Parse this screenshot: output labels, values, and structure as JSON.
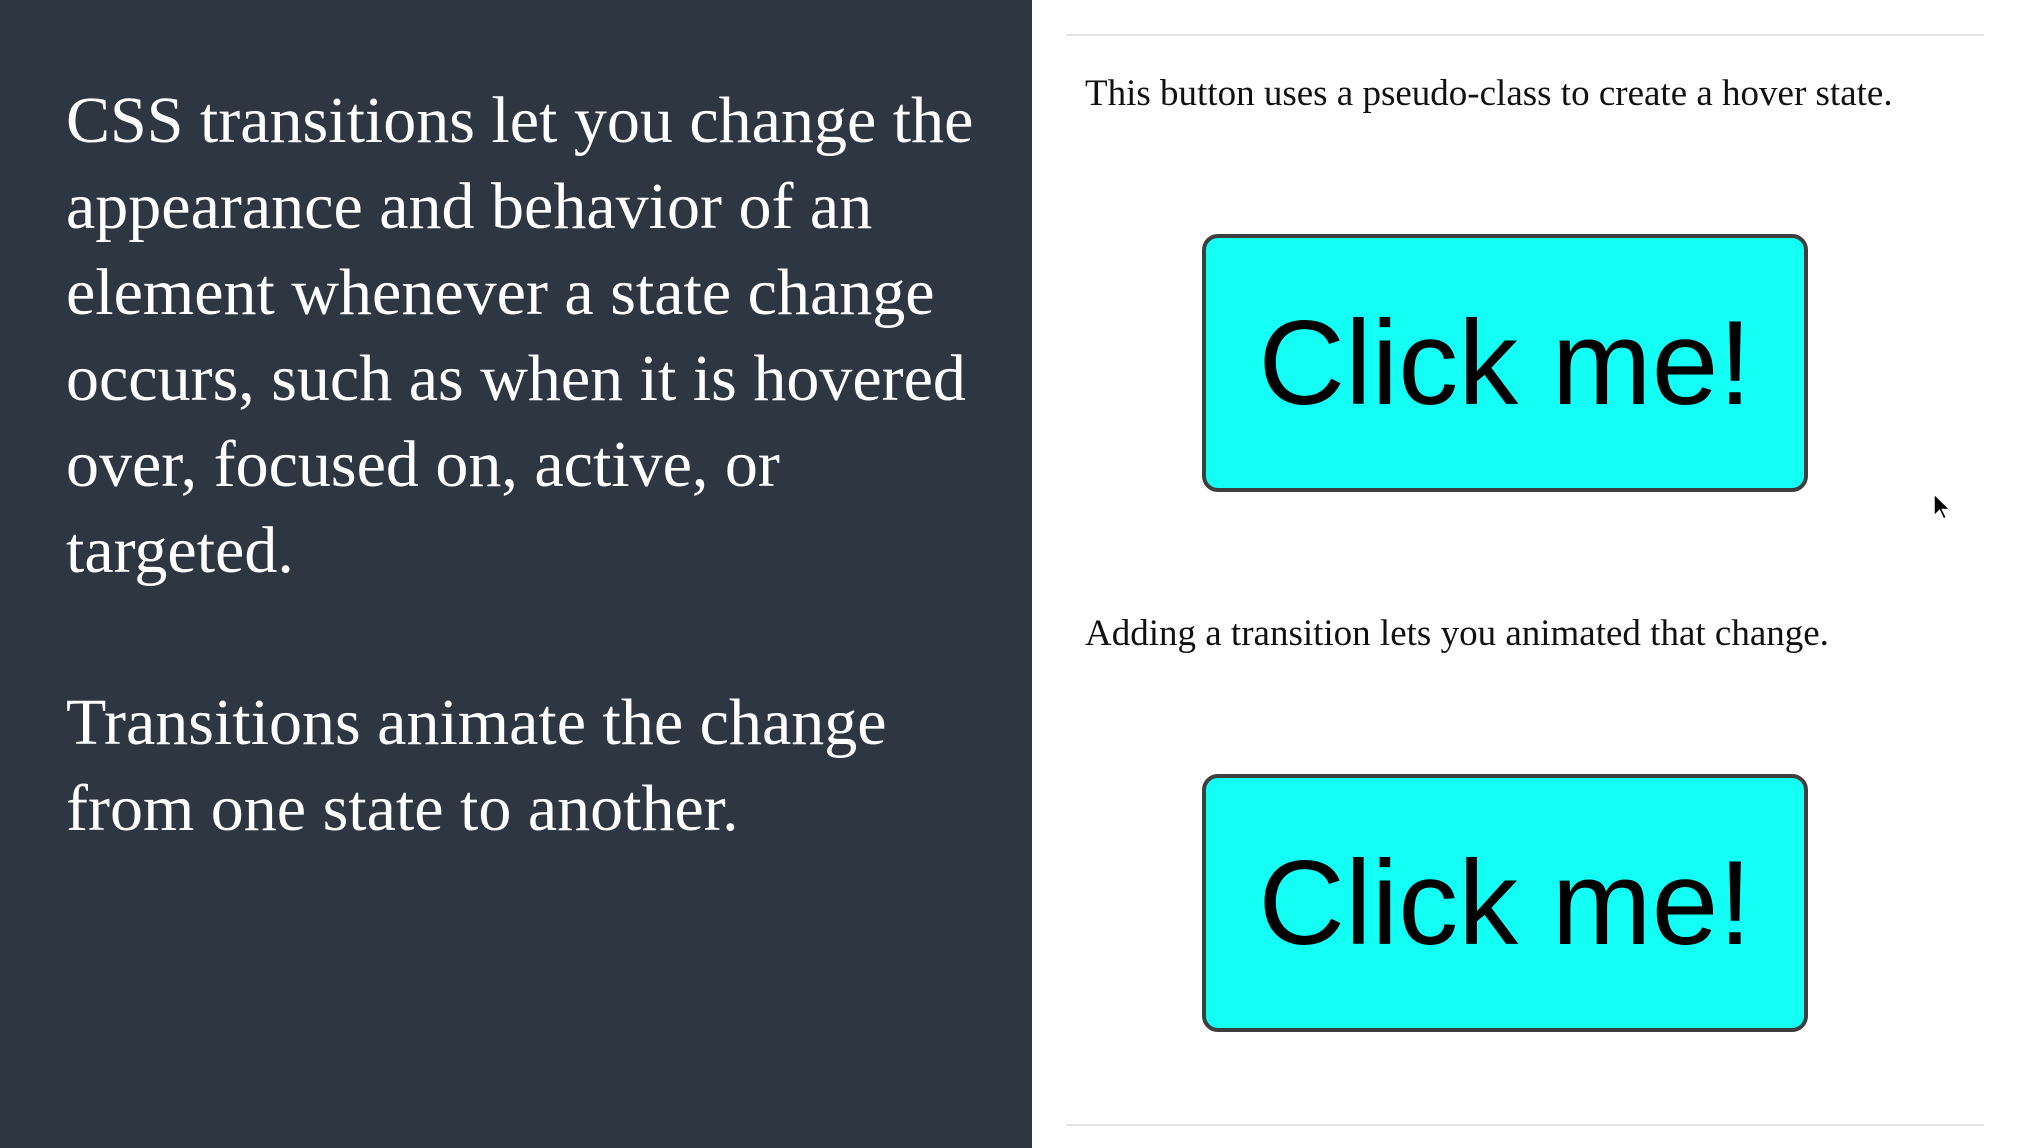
{
  "slide": {
    "left_text": [
      "CSS transitions let you change the appearance and behavior of an element whenever a state change occurs, such as when it is hovered over, focused on, active, or targeted.",
      "Transitions animate the change from one state to another."
    ],
    "demo": {
      "caption_one": "This button uses a pseudo-class to create a hover state.",
      "button_one_label": "Click me!",
      "caption_two": "Adding a transition lets you animated that change.",
      "button_two_label": "Click me!"
    }
  },
  "colors": {
    "left_panel_bg": "#2e3641",
    "button_bg": "#13fff6",
    "button_border": "#3e3e3e"
  },
  "icons": {
    "cursor": "mouse-pointer-icon"
  }
}
